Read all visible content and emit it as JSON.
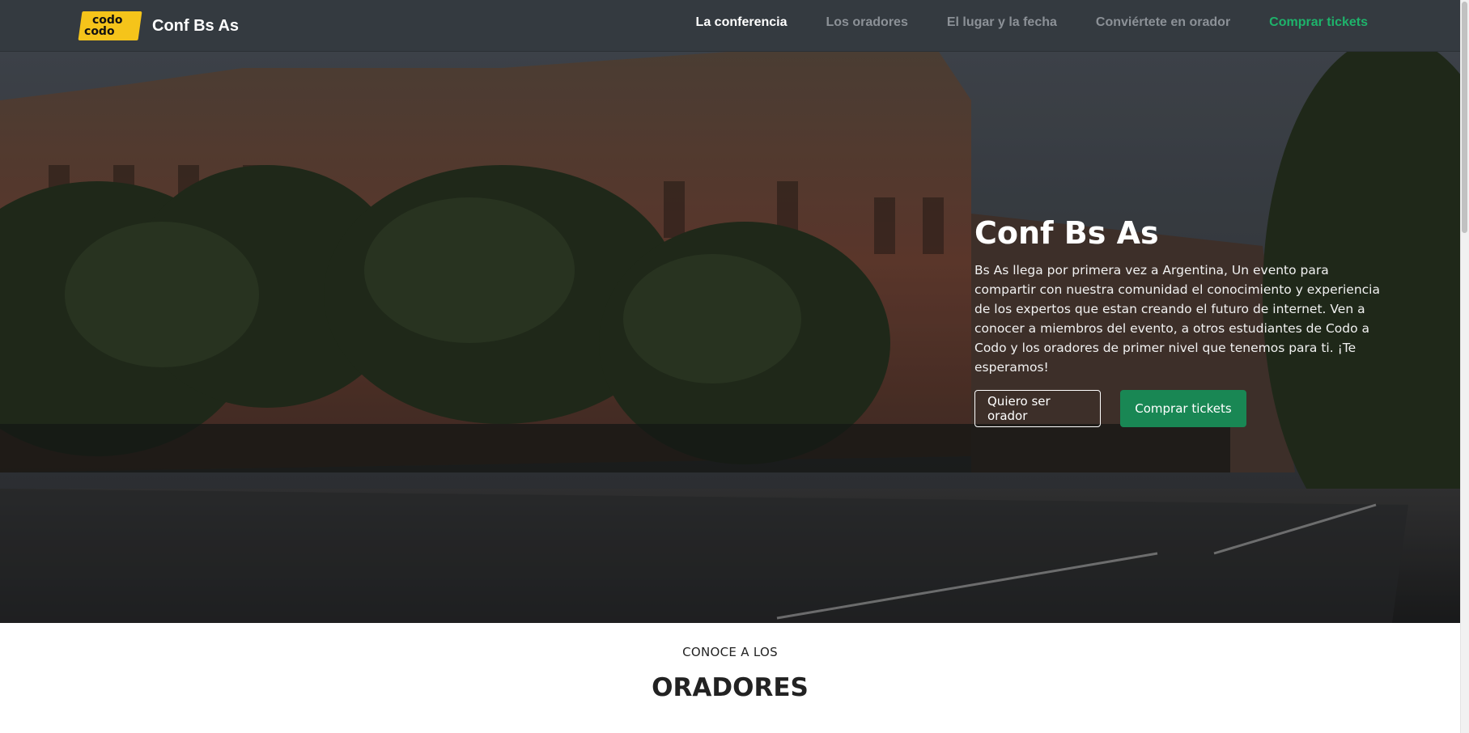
{
  "brand": {
    "logo_line1": "codo",
    "logo_line2": "codo",
    "name": "Conf Bs As"
  },
  "nav": {
    "items": [
      {
        "label": "La conferencia",
        "state": "active"
      },
      {
        "label": "Los oradores",
        "state": "default"
      },
      {
        "label": "El lugar y la fecha",
        "state": "default"
      },
      {
        "label": "Conviértete en orador",
        "state": "default"
      },
      {
        "label": "Comprar tickets",
        "state": "cta"
      }
    ]
  },
  "hero": {
    "title": "Conf Bs As",
    "text": "Bs As llega por primera vez a Argentina, Un evento para compartir con nuestra comunidad el conocimiento y experiencia de los expertos que estan creando el futuro de internet. Ven a conocer a miembros del evento, a otros estudiantes de Codo a Codo y los oradores de primer nivel que tenemos para ti. ¡Te esperamos!",
    "btn_outline": "Quiero ser orador",
    "btn_primary": "Comprar tickets"
  },
  "speakers": {
    "subtitle": "CONOCE A LOS",
    "title": "ORADORES"
  },
  "colors": {
    "navbar": "#343a40",
    "accent": "#198754",
    "nav_cta": "#1eb36b",
    "logo": "#f5c41a"
  }
}
